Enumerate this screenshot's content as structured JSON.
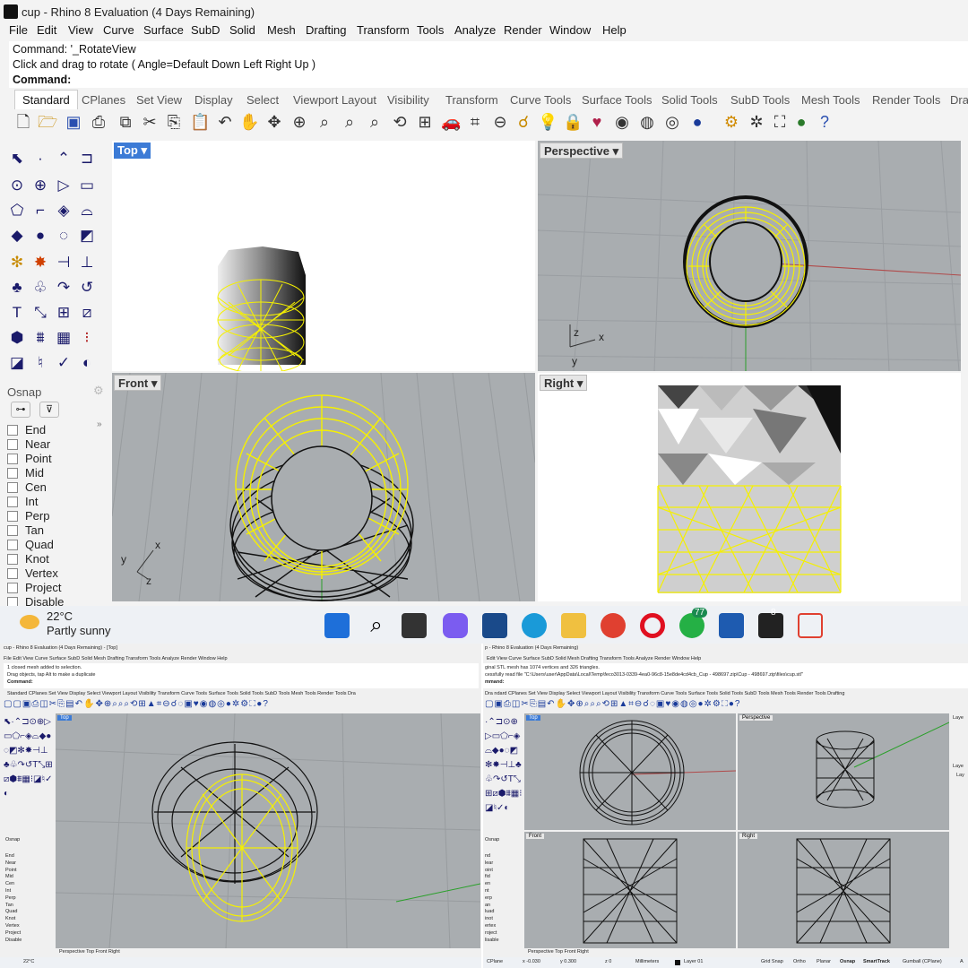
{
  "app": {
    "title": "cup - Rhino 8 Evaluation (4 Days Remaining)"
  },
  "menu": [
    "File",
    "Edit",
    "View",
    "Curve",
    "Surface",
    "SubD",
    "Solid",
    "Mesh",
    "Drafting",
    "Transform",
    "Tools",
    "Analyze",
    "Render",
    "Window",
    "Help"
  ],
  "command": {
    "line1": "Command: '_RotateView",
    "line2": "Click and drag to rotate ( Angle=Default  Down  Left  Right  Up )",
    "prompt": "Command:"
  },
  "tabs": [
    "Standard",
    "CPlanes",
    "Set View",
    "Display",
    "Select",
    "Viewport Layout",
    "Visibility",
    "Transform",
    "Curve Tools",
    "Surface Tools",
    "Solid Tools",
    "SubD Tools",
    "Mesh Tools",
    "Render Tools",
    "Dra"
  ],
  "viewports": {
    "top": "Top",
    "perspective": "Perspective",
    "front": "Front",
    "right": "Right"
  },
  "axes": {
    "z": "z",
    "x": "x",
    "y": "y"
  },
  "osnap": {
    "title": "Osnap",
    "items": [
      "End",
      "Near",
      "Point",
      "Mid",
      "Cen",
      "Int",
      "Perp",
      "Tan",
      "Quad",
      "Knot",
      "Vertex",
      "Project",
      "Disable"
    ]
  },
  "weather": {
    "temp": "22°C",
    "desc": "Partly sunny"
  },
  "taskbar_badges": {
    "whatsapp": "77",
    "rhino": "8"
  },
  "bottom_left": {
    "title": "cup - Rhino 8 Evaluation (4 Days Remaining) - [Top]",
    "menu": "File  Edit  View  Curve  Surface  SubD  Solid  Mesh  Drafting  Transform  Tools  Analyze  Render  Window  Help",
    "line1": "1 closed mesh added to selection.",
    "line2": "Drag objects, tap Alt to make a duplicate",
    "prompt": "Command:",
    "tabs": "Standard   CPlanes   Set View   Display   Select   Viewport Layout   Visibility   Transform   Curve Tools   Surface Tools   Solid Tools   SubD Tools   Mesh Tools   Render Tools   Dra",
    "vp": "Top",
    "osnap_title": "Osnap",
    "osnap": [
      "End",
      "Near",
      "Point",
      "Mid",
      "Cen",
      "Int",
      "Perp",
      "Tan",
      "Quad",
      "Knot",
      "Vertex",
      "Project",
      "Disable"
    ],
    "vptabs": "Perspective   Top   Front   Right",
    "temp": "22°C"
  },
  "bottom_right": {
    "title": "p - Rhino 8 Evaluation (4 Days Remaining)",
    "menu": "Edit  View  Curve  Surface  SubD  Solid  Mesh  Drafting  Transform  Tools  Analyze  Render  Window  Help",
    "line1": "ginal STL mesh has 1074 vertices and 326 triangles.",
    "line2": "cessfully read file \"C:\\Users\\user\\AppData\\Local\\Temp\\feco3013-0339-4ea0-96c8-15e8de4cd4cb_Cup - 498697.zip\\Cup - 498697.zip\\files\\cup.stl\"",
    "prompt": "mmand:",
    "tabs": "Dra ndard   CPlanes   Set View   Display   Select   Viewport Layout   Visibility   Transform   Curve Tools   Surface Tools   Solid Tools   SubD Tools   Mesh Tools   Render Tools   Drafting",
    "vp_top": "Top",
    "vp_persp": "Perspective",
    "vp_front": "Front",
    "vp_right": "Right",
    "osnap_title": "Osnap",
    "osnap": [
      "nd",
      "lear",
      "oint",
      "fid",
      "en",
      "nt",
      "erp",
      "an",
      "luad",
      "inot",
      "ertex",
      "roject",
      "lisable"
    ],
    "vptabs": "Perspective   Top   Front   Right",
    "status": {
      "cplane": "CPlane",
      "x": "x -0.030",
      "y": "y 0.300",
      "z": "z 0",
      "units": "Millimeters",
      "layer": "Layer 01",
      "grid": "Grid Snap",
      "ortho": "Ortho",
      "planar": "Planar",
      "osnap": "Osnap",
      "smarttrack": "SmartTrack",
      "gumball": "Gumball (CPlane)",
      "extra": "A"
    },
    "layers_label": "Laye",
    "layers_label2": "Laye",
    "layers_label3": "Lay"
  },
  "colors": {
    "accent": "#3c7bd6",
    "wire_yellow": "#f5f000",
    "vp_gray": "#a9adb0",
    "grid_white": "#ffffff"
  }
}
